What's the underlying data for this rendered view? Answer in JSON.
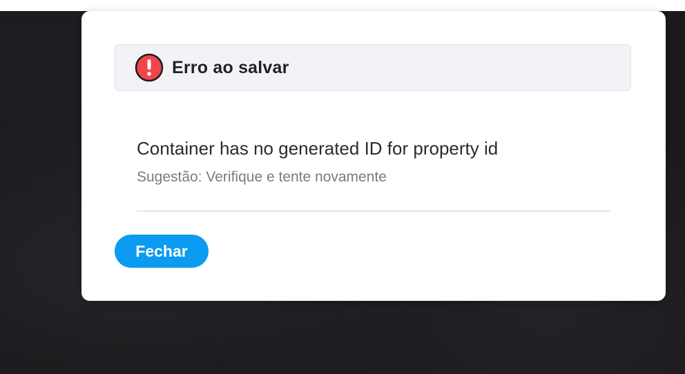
{
  "dialog": {
    "title": "Erro ao salvar",
    "message": "Container has no generated ID for property id",
    "suggestion": "Sugestão: Verifique e tente novamente",
    "close_label": "Fechar",
    "icon": "alert-circle-icon"
  },
  "colors": {
    "alert_red": "#f0454a",
    "button_blue": "#0b9bf0",
    "header_bg": "#f2f3f7",
    "backdrop": "#1a1a1d"
  }
}
